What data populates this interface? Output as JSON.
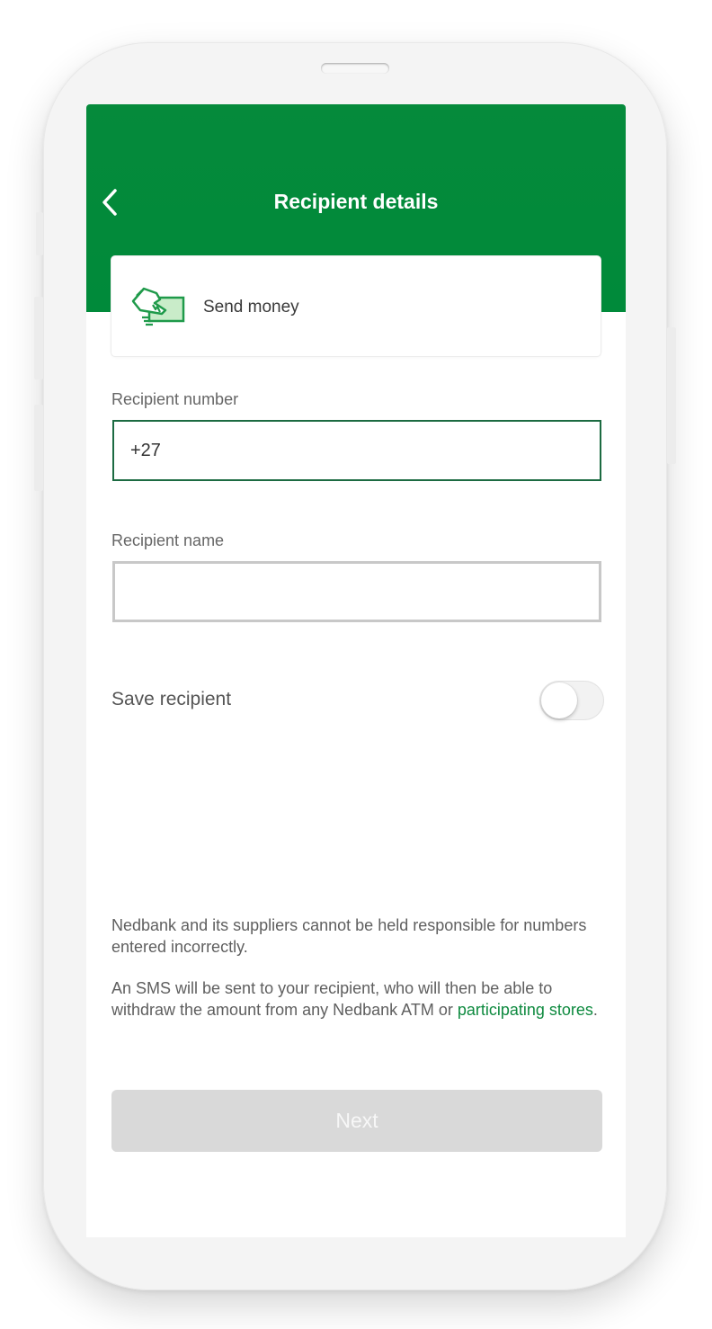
{
  "header": {
    "title": "Recipient details",
    "back_icon": "chevron-left-icon"
  },
  "service_card": {
    "label": "Send money",
    "icon": "hand-with-cash-icon"
  },
  "recipient_number": {
    "label": "Recipient number",
    "value": "+27"
  },
  "recipient_name": {
    "label": "Recipient name",
    "value": ""
  },
  "save_recipient": {
    "label": "Save recipient",
    "enabled": false
  },
  "disclaimer": {
    "responsibility": "Nedbank and its suppliers cannot be held responsible for numbers entered incorrectly.",
    "sms_text": "An SMS will be sent to your recipient, who will then be able to withdraw the amount from any Nedbank ATM or ",
    "stores_link": "participating stores",
    "end_punctuation": "."
  },
  "actions": {
    "next_label": "Next",
    "next_enabled": false
  },
  "colors": {
    "brand_green": "#008a3a",
    "link_green": "#0e8a3f",
    "active_border": "#1c6b42",
    "disabled_button": "#d9d9d9"
  }
}
